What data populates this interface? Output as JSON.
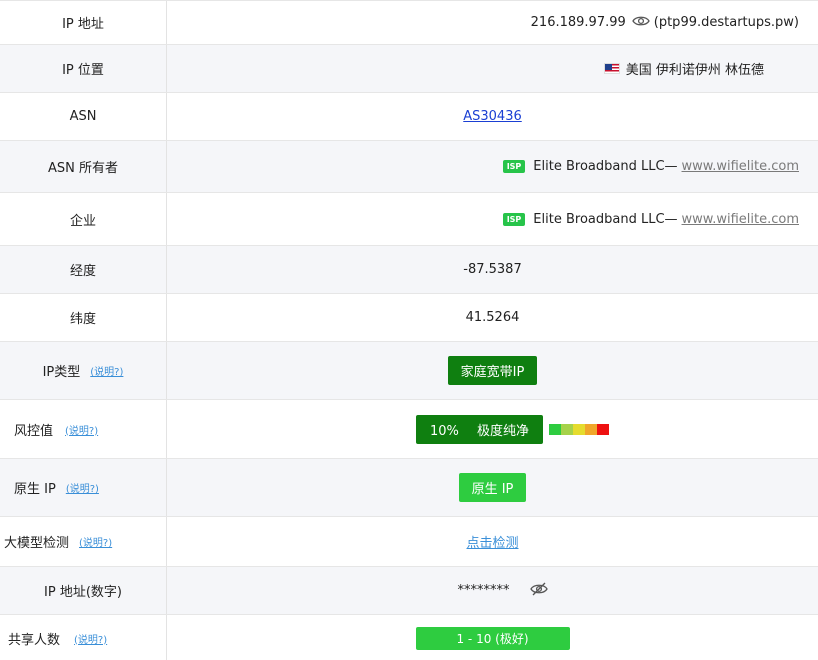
{
  "rows": {
    "ip": {
      "label": "IP 地址",
      "value": "216.189.97.99",
      "hostname": "(ptp99.destartups.pw)"
    },
    "location": {
      "label": "IP 位置",
      "value": "美国 伊利诺伊州 林伍德"
    },
    "asn": {
      "label": "ASN",
      "value": "AS30436"
    },
    "asn_owner": {
      "label": "ASN 所有者",
      "badge": "ISP",
      "name": "Elite Broadband LLC—",
      "site": "www.wifielite.com"
    },
    "company": {
      "label": "企业",
      "badge": "ISP",
      "name": "Elite Broadband LLC—",
      "site": "www.wifielite.com"
    },
    "longitude": {
      "label": "经度",
      "value": "-87.5387"
    },
    "latitude": {
      "label": "纬度",
      "value": "41.5264"
    },
    "ip_type": {
      "label": "IP类型",
      "help": "(说明?)",
      "value": "家庭宽带IP"
    },
    "risk": {
      "label": "风控值",
      "help": "(说明?)",
      "percent": "10%",
      "desc": "极度纯净",
      "scale_colors": [
        "#2ecc40",
        "#a6d24a",
        "#e5dc2e",
        "#f0a62a",
        "#ee1111"
      ]
    },
    "native": {
      "label": "原生 IP",
      "help": "(说明?)",
      "value": "原生 IP"
    },
    "llm": {
      "label": "大模型检测",
      "help": "(说明?)",
      "value": "点击检测"
    },
    "ip_numeric": {
      "label": "IP 地址(数字)",
      "value": "********"
    },
    "share": {
      "label": "共享人数",
      "help": "(说明?)",
      "value": "1 - 10 (极好)"
    }
  },
  "icons": {
    "eye": "eye-icon",
    "eye_off": "eye-off-icon",
    "flag": "us-flag-icon"
  },
  "colors": {
    "green_dark": "#0f7f10",
    "green_light": "#2ecc40",
    "link": "#1a3fd3",
    "help": "#3a8fd8"
  }
}
